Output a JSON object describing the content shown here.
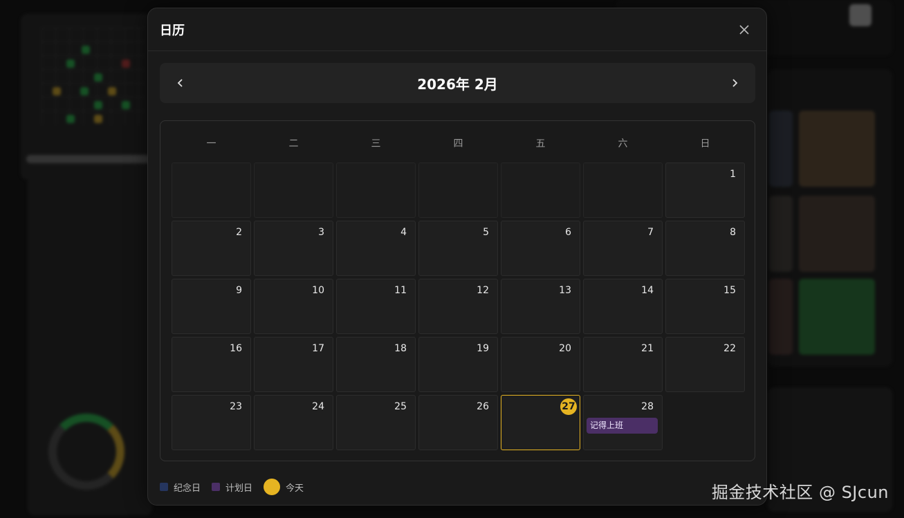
{
  "colors": {
    "today": "#e6b422",
    "anniversary": "#25355e",
    "planned": "#4b2f66",
    "modal_bg": "#1a1a1a"
  },
  "modal": {
    "title": "日历",
    "close_icon": "close-icon"
  },
  "calendar": {
    "month_label": "2026年 2月",
    "prev_icon": "chevron-left-icon",
    "next_icon": "chevron-right-icon",
    "weekdays": [
      "一",
      "二",
      "三",
      "四",
      "五",
      "六",
      "日"
    ],
    "today": "27",
    "days": [
      "",
      "",
      "",
      "",
      "",
      "",
      "1",
      "2",
      "3",
      "4",
      "5",
      "6",
      "7",
      "8",
      "9",
      "10",
      "11",
      "12",
      "13",
      "14",
      "15",
      "16",
      "17",
      "18",
      "19",
      "20",
      "21",
      "22",
      "23",
      "24",
      "25",
      "26",
      "27",
      "28",
      ""
    ],
    "events": [
      {
        "day": "28",
        "label": "记得上班",
        "type": "planned"
      }
    ]
  },
  "legend": {
    "anniversary": "纪念日",
    "planned": "计划日",
    "today": "今天"
  },
  "watermark": "掘金技术社区 @ SJcun"
}
